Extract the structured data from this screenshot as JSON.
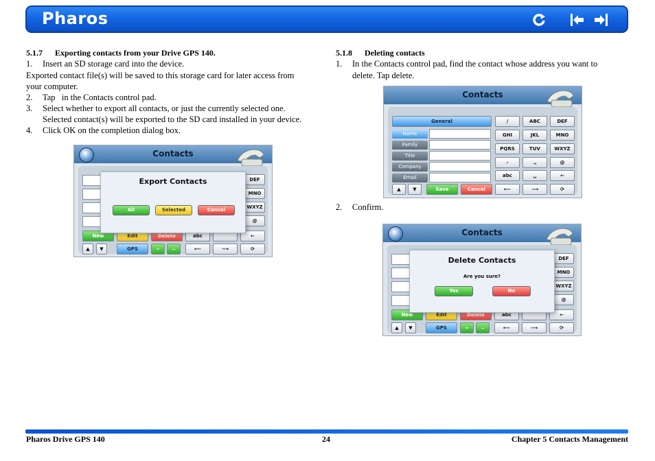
{
  "header": {
    "brand": "Pharos"
  },
  "left": {
    "heading_num": "5.1.7",
    "heading_text": "Exporting contacts from your Drive GPS 140.",
    "step1_num": "1.",
    "step1": "Insert an SD storage card into the device.",
    "para1": "Exported contact file(s) will be saved to this storage card for later access from",
    "para2": "your computer.",
    "step2_num": "2.",
    "step2": "Tap   in the Contacts control pad.",
    "step3_num": "3.",
    "step3a": "Select whether to export all contacts, or just the currently selected one.",
    "step3b": "Selected contact(s) will be exported to the SD card installed in your device.",
    "step4_num": "4.",
    "step4": "Click OK on the completion dialog box."
  },
  "right": {
    "heading_num": "5.1.8",
    "heading_text": "Deleting contacts",
    "step1_num": "1.",
    "step1a": "In the Contacts control pad, find the contact whose address you want to",
    "step1b": "delete. Tap delete.",
    "step2_num": "2.",
    "step2": "Confirm."
  },
  "screen_export": {
    "title": "Contacts",
    "dialog_title": "Export Contacts",
    "btn_all": "All",
    "btn_selected": "Selected",
    "btn_cancel": "Cancel",
    "keys": [
      "DEF",
      "MNO",
      "WXYZ",
      "@"
    ],
    "bottom": {
      "new": "New",
      "edit": "Edit",
      "delete": "Delete",
      "abc": "abc",
      "gps": "GPS"
    }
  },
  "screen_edit": {
    "title": "Contacts",
    "tab": "General",
    "labels": [
      "Name",
      "Family",
      "Title",
      "Company",
      "Email"
    ],
    "keys": [
      "/",
      "ABC",
      "DEF",
      "GHI",
      "JKL",
      "MNO",
      "PQRS",
      "TUV",
      "WXYZ",
      "-",
      ".,",
      "@",
      "abc"
    ],
    "save": "Save",
    "cancel": "Cancel"
  },
  "screen_delete": {
    "title": "Contacts",
    "dialog_title": "Delete Contacts",
    "question": "Are you sure?",
    "btn_yes": "Yes",
    "btn_no": "No",
    "keys": [
      "DEF",
      "MNO",
      "WXYZ",
      "@"
    ],
    "bottom": {
      "new": "New",
      "edit": "Edit",
      "delete": "Delete",
      "abc": "abc",
      "gps": "GPS"
    }
  },
  "footer": {
    "left": "Pharos Drive GPS 140",
    "page": "24",
    "right": "Chapter 5 Contacts Management"
  },
  "colors": {
    "header_blue": "#1466e3",
    "footer_blue": "#0a55d0"
  }
}
